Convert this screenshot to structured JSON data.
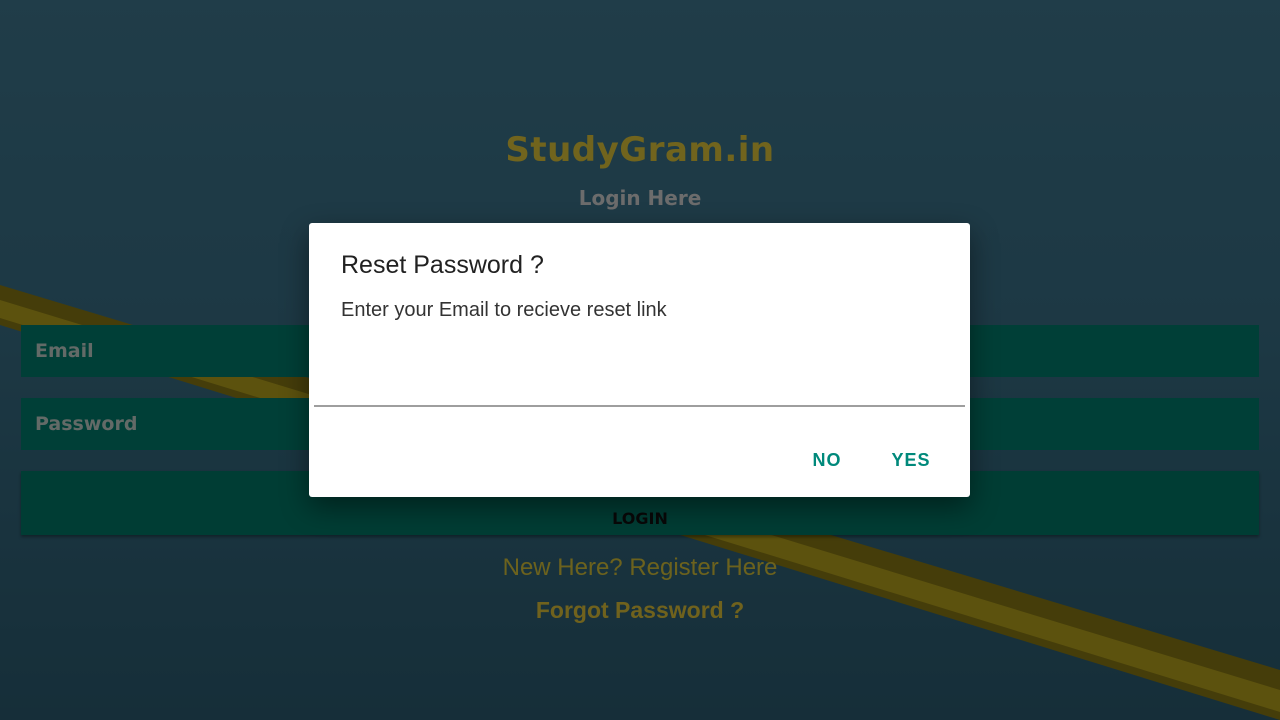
{
  "app": {
    "brand": "StudyGram.in",
    "subtitle": "Login Here"
  },
  "login_form": {
    "email_placeholder": "Email",
    "password_placeholder": "Password",
    "login_label": "LOGIN",
    "register_link": "New Here? Register Here",
    "forgot_link": "Forgot Password ?"
  },
  "dialog": {
    "title": "Reset Password ?",
    "message": "Enter your Email to recieve reset link",
    "input_value": "",
    "no_label": "NO",
    "yes_label": "YES"
  },
  "colors": {
    "accent": "#00897b",
    "brand": "#e3c93a",
    "field": "#007f6e"
  }
}
